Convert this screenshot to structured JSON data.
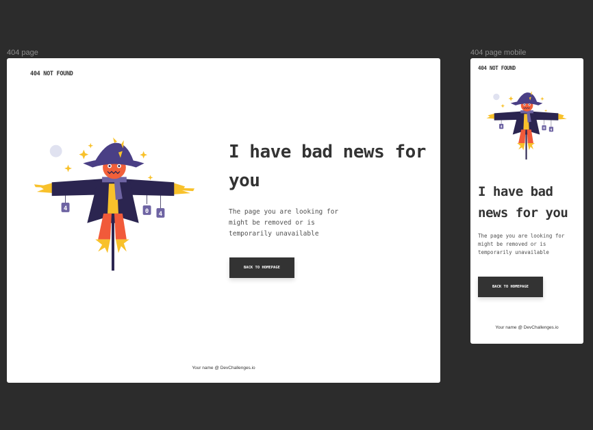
{
  "frames": {
    "desktop": {
      "label": "404 page",
      "brand": "404 NOT FOUND",
      "headline": "I have bad news for you",
      "description": "The page you are looking for might be removed or is temporarily unavailable",
      "button_label": "BACK TO HOMEPAGE",
      "footer": "Your name @ DevChallenges.io"
    },
    "mobile": {
      "label": "404 page mobile",
      "brand": "404 NOT FOUND",
      "headline": "I have bad news for you",
      "description": "The page you are looking for might be removed or is temporarily unavailable",
      "button_label": "BACK TO HOMEPAGE",
      "footer": "Your name @ DevChallenges.io"
    }
  },
  "illustration": {
    "subject": "scarecrow-illustration",
    "sign_digits": [
      "4",
      "0",
      "4"
    ]
  },
  "colors": {
    "canvas": "#2c2c2c",
    "frame_bg": "#ffffff",
    "text_dark": "#333333",
    "text_muted": "#4f4f4f",
    "button_bg": "#333333",
    "button_text": "#ffffff",
    "scarecrow_coat": "#2b2550",
    "scarecrow_hat": "#4a3f85",
    "scarecrow_face": "#f2603a",
    "scarecrow_straw": "#f8c12b",
    "scarecrow_pants": "#f15a3a",
    "scarecrow_sign": "#6e64a3",
    "sparkle": "#f8c12b",
    "moon": "#e0e2f0"
  }
}
